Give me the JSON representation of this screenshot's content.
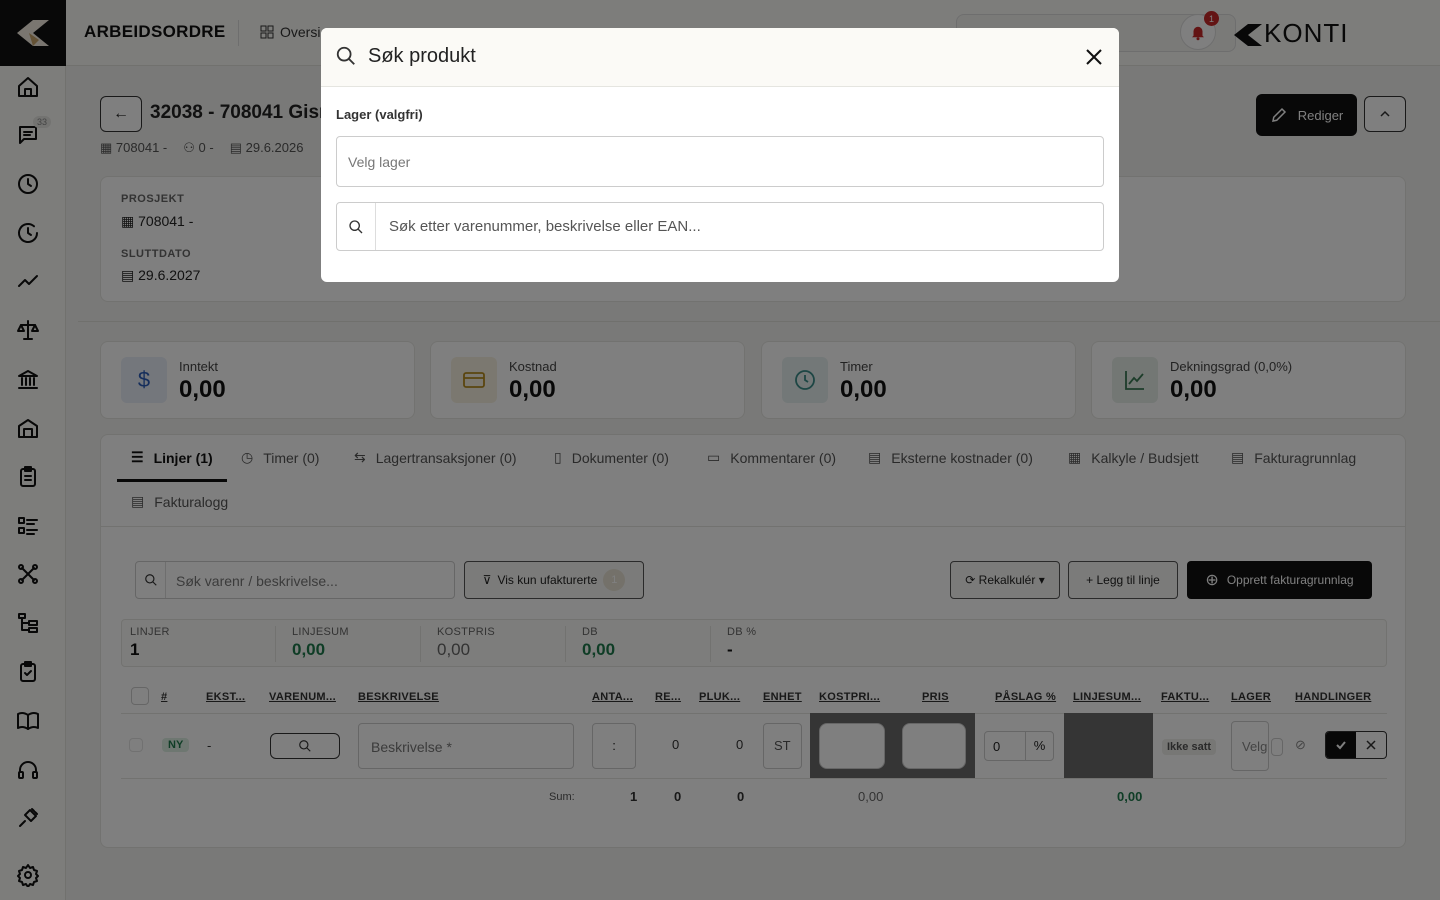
{
  "app": {
    "title": "ARBEIDSORDRE",
    "brand": "KONTI",
    "notification_count": "1"
  },
  "top_nav": {
    "overview": "Oversi"
  },
  "sidebar": {
    "messages_badge": "33"
  },
  "header": {
    "title": "32038 - 708041 Gisr",
    "meta_project": "708041 -",
    "meta_person": "0 -",
    "meta_date": "29.6.2026",
    "edit_label": "Rediger"
  },
  "info": {
    "project_label": "PROSJEKT",
    "project_value": "708041 -",
    "end_label": "SLUTTDATO",
    "end_value": "29.6.2027"
  },
  "stats": [
    {
      "label": "Inntekt",
      "value": "0,00",
      "icon": "dollar-icon",
      "color": "#e8eef8"
    },
    {
      "label": "Kostnad",
      "value": "0,00",
      "icon": "card-icon",
      "color": "#f7f1e0"
    },
    {
      "label": "Timer",
      "value": "0,00",
      "icon": "clock-icon",
      "color": "#e6f1f0"
    },
    {
      "label": "Dekningsgrad (0,0%)",
      "value": "0,00",
      "icon": "chart-icon",
      "color": "#e6efe9"
    }
  ],
  "tabs": [
    {
      "label": "Linjer (1)"
    },
    {
      "label": "Timer (0)"
    },
    {
      "label": "Lagertransaksjoner (0)"
    },
    {
      "label": "Dokumenter (0)"
    },
    {
      "label": "Kommentarer (0)"
    },
    {
      "label": "Eksterne kostnader (0)"
    },
    {
      "label": "Kalkyle / Budsjett"
    },
    {
      "label": "Fakturagrunnlag"
    },
    {
      "label": "Fakturalogg"
    }
  ],
  "toolbar": {
    "search_placeholder": "Søk varenr / beskrivelse...",
    "filter_label": "Vis kun ufakturerte",
    "filter_count": "1",
    "recalc_label": "Rekalkulér",
    "add_line_label": "Legg til linje",
    "create_label": "Opprett fakturagrunnlag"
  },
  "summary": [
    {
      "label": "LINJER",
      "value": "1"
    },
    {
      "label": "LINJESUM",
      "value": "0,00"
    },
    {
      "label": "KOSTPRIS",
      "value": "0,00"
    },
    {
      "label": "DB",
      "value": "0,00"
    },
    {
      "label": "DB %",
      "value": "-"
    }
  ],
  "columns": [
    "#",
    "EKST...",
    "VARENUM...",
    "BESKRIVELSE",
    "ANTA...",
    "RE...",
    "PLUK...",
    "ENHET",
    "KOSTPRI...",
    "PRIS",
    "PÅSLAG %",
    "LINJESUM...",
    "FAKTU...",
    "LAGER",
    "HANDLINGER"
  ],
  "row": {
    "status_badge": "NY",
    "ekst": "-",
    "description_placeholder": "Beskrivelse *",
    "antall": ":",
    "rest": "0",
    "pluk": "0",
    "enhet": "ST",
    "paslag": "0",
    "paslag_unit": "%",
    "faktura": "Ikke satt",
    "lager_placeholder": "Velg"
  },
  "sum_row": {
    "label": "Sum:",
    "antall": "1",
    "rest": "0",
    "pluk": "0",
    "kostpris": "0,00",
    "linjesum": "0,00"
  },
  "modal": {
    "title": "Søk produkt",
    "warehouse_label": "Lager (valgfri)",
    "warehouse_placeholder": "Velg lager",
    "search_placeholder": "Søk etter varenummer, beskrivelse eller EAN..."
  }
}
